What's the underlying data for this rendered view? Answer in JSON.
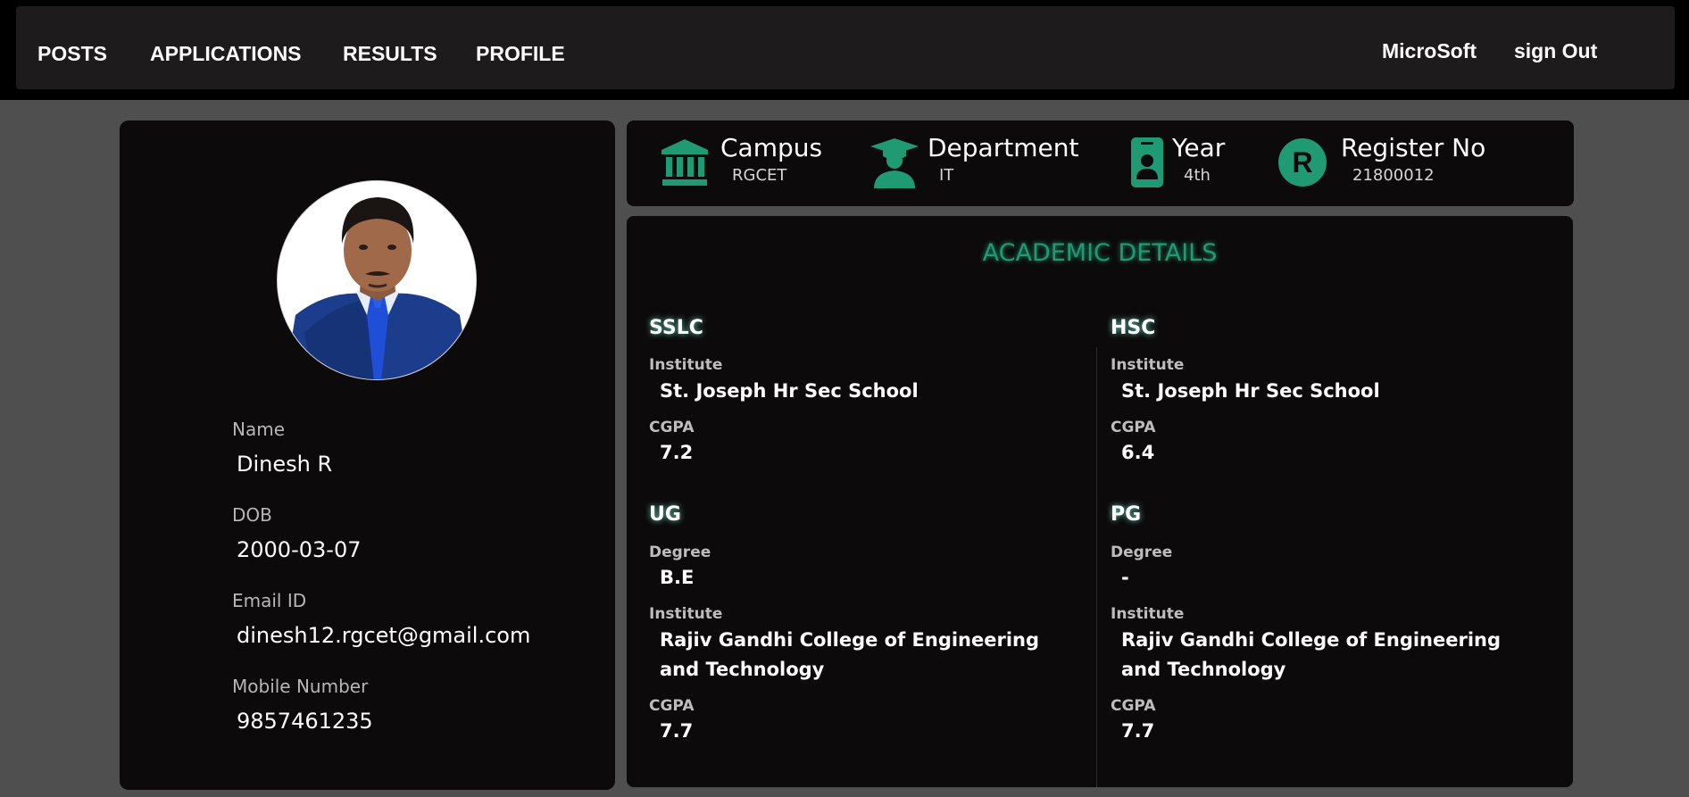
{
  "nav": {
    "links": [
      "POSTS",
      "APPLICATIONS",
      "RESULTS",
      "PROFILE"
    ],
    "company": "MicroSoft",
    "signout": "sign Out"
  },
  "profile": {
    "name_label": "Name",
    "name": "Dinesh R",
    "dob_label": "DOB",
    "dob": "2000-03-07",
    "email_label": "Email ID",
    "email": "dinesh12.rgcet@gmail.com",
    "mobile_label": "Mobile Number",
    "mobile": "9857461235"
  },
  "info": {
    "campus_label": "Campus",
    "campus": "RGCET",
    "department_label": "Department",
    "department": "IT",
    "year_label": "Year",
    "year": "4th",
    "register_label": "Register No",
    "register": "21800012",
    "register_badge": "R"
  },
  "academic": {
    "title": "ACADEMIC DETAILS",
    "sslc": {
      "heading": "SSLC",
      "institute_label": "Institute",
      "institute": "St. Joseph Hr Sec School",
      "cgpa_label": "CGPA",
      "cgpa": "7.2"
    },
    "hsc": {
      "heading": "HSC",
      "institute_label": "Institute",
      "institute": "St. Joseph Hr Sec School",
      "cgpa_label": "CGPA",
      "cgpa": "6.4"
    },
    "ug": {
      "heading": "UG",
      "degree_label": "Degree",
      "degree": "B.E",
      "institute_label": "Institute",
      "institute": "Rajiv Gandhi College of Engineering and Technology",
      "cgpa_label": "CGPA",
      "cgpa": "7.7"
    },
    "pg": {
      "heading": "PG",
      "degree_label": "Degree",
      "degree": "-",
      "institute_label": "Institute",
      "institute": "Rajiv Gandhi College of Engineering and Technology",
      "cgpa_label": "CGPA",
      "cgpa": "7.7"
    }
  },
  "colors": {
    "accent": "#1f9a72",
    "card_bg": "#0c0a0a",
    "nav_bg": "#1d1b1c",
    "page_bg": "#4f4f4f"
  },
  "icons": [
    "bank-icon",
    "graduate-icon",
    "id-badge-icon",
    "register-badge-icon",
    "profile-photo"
  ]
}
